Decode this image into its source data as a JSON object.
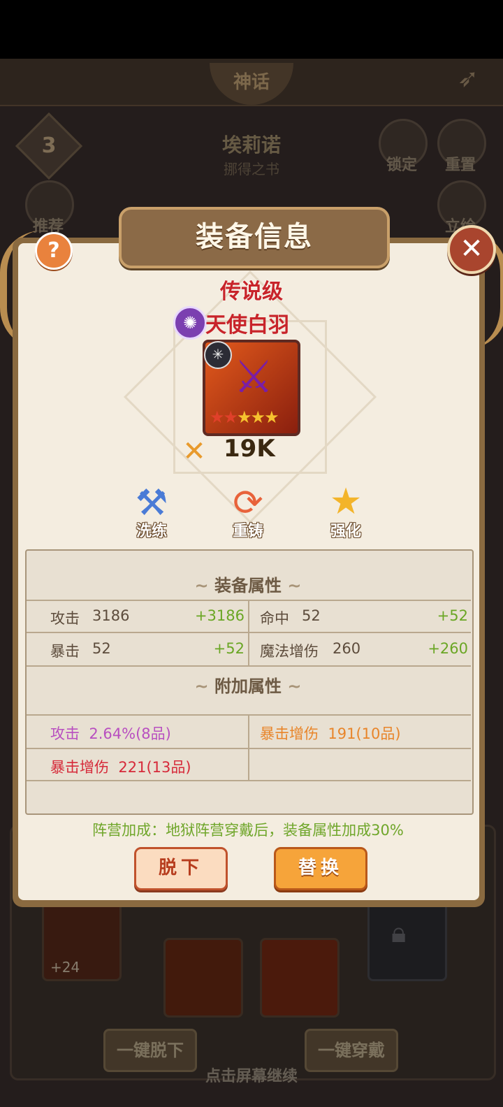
{
  "background": {
    "myth_tab": "神话",
    "hero_level": "3",
    "hero_name": "埃莉诺",
    "hero_subtitle": "挪得之书",
    "lock_label": "锁定",
    "reset_label": "重置",
    "recommend_label": "推荐",
    "stand_label": "立绘",
    "slot_plus": "+24",
    "unequip_all": "一键脱下",
    "equip_all": "一键穿戴",
    "tap_continue": "点击屏幕继续"
  },
  "dialog": {
    "title": "装备信息",
    "help": "?",
    "close": "✕",
    "grade": "传说级",
    "item_name": "天使白羽",
    "power": "19K",
    "stars": {
      "red": 2,
      "gold": 3
    },
    "actions": [
      {
        "label": "洗练",
        "icon": "hammer-icon"
      },
      {
        "label": "重铸",
        "icon": "reforge-icon"
      },
      {
        "label": "强化",
        "icon": "star-icon"
      }
    ],
    "base_section": "装备属性",
    "extra_section": "附加属性",
    "base_stats": [
      {
        "name": "攻击",
        "value": "3186",
        "bonus": "+3186"
      },
      {
        "name": "命中",
        "value": "52",
        "bonus": "+52"
      },
      {
        "name": "暴击",
        "value": "52",
        "bonus": "+52"
      },
      {
        "name": "魔法增伤",
        "value": "260",
        "bonus": "+260"
      }
    ],
    "extra_stats": [
      {
        "name": "攻击",
        "value": "2.64%(8品)",
        "color": "#b84fc0"
      },
      {
        "name": "暴击增伤",
        "value": "191(10品)",
        "color": "#e8852a"
      },
      {
        "name": "暴击增伤",
        "value": "221(13品)",
        "color": "#d62a3a"
      }
    ],
    "faction_bonus": "阵营加成：地狱阵营穿戴后，装备属性加成30%",
    "btn_unequip": "脱下",
    "btn_replace": "替换"
  }
}
